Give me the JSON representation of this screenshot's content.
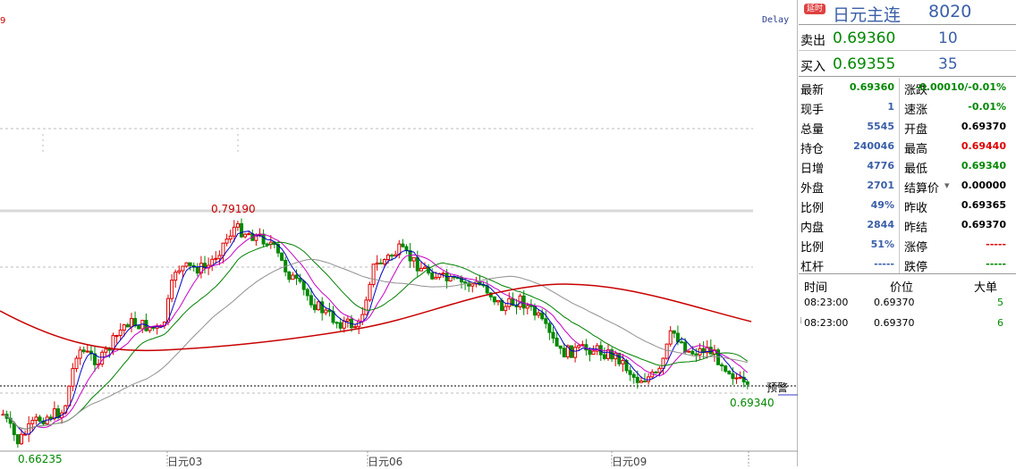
{
  "header": {
    "badge": "延时",
    "instrument": "日元主连",
    "code": "8020"
  },
  "chart": {
    "delay_label": "Delay",
    "top_left_fragment": "9",
    "high_label": "0.79190",
    "low_label": "0.66235",
    "last_label": "0.69340",
    "alert_label": "预警",
    "x_labels": [
      "日元03",
      "日元06",
      "日元09"
    ],
    "colors": {
      "up": "#e00000",
      "down": "#008800",
      "ma_white": "#7a7a7a",
      "ma_yellow": "#0000c8",
      "ma_purple": "#c800c8",
      "ma_green": "#008000",
      "ma_gray": "#909090",
      "ma_red": "#c80000"
    }
  },
  "quote": {
    "sell_label": "卖出",
    "sell_price": "0.69360",
    "sell_vol": "10",
    "buy_label": "买入",
    "buy_price": "0.69355",
    "buy_vol": "35"
  },
  "stats_left": [
    {
      "label": "最新",
      "value": "0.69360",
      "color": "#008800"
    },
    {
      "label": "现手",
      "value": "1",
      "color": "#3a5ea8"
    },
    {
      "label": "总量",
      "value": "5545",
      "color": "#3a5ea8"
    },
    {
      "label": "持仓",
      "value": "240046",
      "color": "#3a5ea8"
    },
    {
      "label": "日增",
      "value": "4776",
      "color": "#3a5ea8"
    },
    {
      "label": "外盘",
      "value": "2701",
      "color": "#3a5ea8"
    },
    {
      "label": "比例",
      "value": "49%",
      "color": "#3a5ea8"
    },
    {
      "label": "内盘",
      "value": "2844",
      "color": "#3a5ea8"
    },
    {
      "label": "比例",
      "value": "51%",
      "color": "#3a5ea8"
    },
    {
      "label": "杠杆",
      "value": "-----",
      "color": "#3a5ea8"
    }
  ],
  "stats_right": [
    {
      "label": "涨跌",
      "value": "-0.00010/-0.01%",
      "color": "#008800"
    },
    {
      "label": "速涨",
      "value": "-0.01%",
      "color": "#008800"
    },
    {
      "label": "开盘",
      "value": "0.69370",
      "color": "#000000"
    },
    {
      "label": "最高",
      "value": "0.69440",
      "color": "#e00000"
    },
    {
      "label": "最低",
      "value": "0.69340",
      "color": "#008800"
    },
    {
      "label": "结算价",
      "value": "0.00000",
      "color": "#000000"
    },
    {
      "label": "昨收",
      "value": "0.69365",
      "color": "#000000"
    },
    {
      "label": "昨结",
      "value": "0.69370",
      "color": "#000000"
    },
    {
      "label": "涨停",
      "value": "-----",
      "color": "#e00000"
    },
    {
      "label": "跌停",
      "value": "-----",
      "color": "#008800"
    }
  ],
  "ticks": {
    "headers": [
      "时间",
      "价位",
      "大单"
    ],
    "rows": [
      {
        "time": "08:23:00",
        "price": "0.69370",
        "vol": "5"
      },
      {
        "time": "08:23:00",
        "price": "0.69370",
        "vol": "6"
      }
    ]
  }
}
